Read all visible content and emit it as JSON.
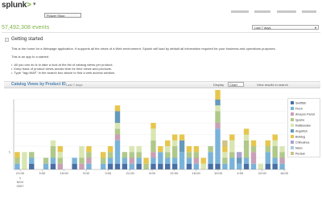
{
  "header": {
    "logo_text": "splunk",
    "logo_suffix": ">",
    "app_select_value": "Flower Shop",
    "app_select_caret": "▾"
  },
  "search": {
    "events_count": "57,492,308 events",
    "time_range": "Last 7 days",
    "time_range_caret": "▾"
  },
  "getting_started": {
    "title": "Getting started",
    "paragraph_1": "This is the home for a Webpage application. It supports all the views of a Web environment. Splunk will load by default all information required for your business and operations purposes.",
    "paragraph_2": "This is an app to a started.",
    "bullets": [
      "All you can do is to take a look at the list of catalog views per product.",
      "Keep track of product views across time for time views and products.",
      "Type \"tag=WAF\" in the search box above to find a web access window."
    ]
  },
  "panel": {
    "title": "Catalog Views by Product ID",
    "subtitle": "Last 7 days",
    "display_label": "Display",
    "display_value": "Chart",
    "link_text": "View results in search"
  },
  "chart_data": {
    "type": "bar",
    "stacked": true,
    "ylim": [
      0,
      12
    ],
    "y_ticks": [
      "1"
    ],
    "x_tick_labels": [
      "21:00",
      "3:00",
      "15:00",
      "9:00",
      "3:00",
      "21:00",
      "9:00",
      "22:00",
      "16:00",
      "10:00",
      "4:00",
      "22:00",
      "16:00"
    ],
    "date_label_day": "1",
    "date_label_month": "NOV",
    "date_label_year": "2007",
    "series": [
      {
        "name": "Swiftfish",
        "color": "#4a6fa5",
        "values": [
          0,
          0,
          1,
          0,
          0,
          1,
          0,
          0,
          1,
          0,
          0,
          0,
          0,
          1,
          1,
          1,
          0,
          1,
          0,
          1,
          1,
          1,
          1,
          0,
          1,
          0,
          0,
          1,
          1,
          0,
          0,
          0,
          1,
          0,
          0,
          1,
          1,
          0
        ]
      },
      {
        "name": "Finch",
        "color": "#7ab3d9",
        "values": [
          1,
          0,
          1,
          0,
          1,
          1,
          0,
          0,
          1,
          0,
          1,
          0,
          1,
          1,
          4,
          1,
          1,
          1,
          0,
          1,
          2,
          1,
          1,
          3,
          1,
          1,
          0,
          2,
          6,
          1,
          2,
          1,
          1,
          1,
          0,
          2,
          1,
          1
        ]
      },
      {
        "name": "Amazon Parrot",
        "color": "#c9a0b5",
        "values": [
          0,
          0,
          0,
          0,
          0,
          0,
          1,
          0,
          0,
          1,
          1,
          0,
          0,
          0,
          1,
          0,
          1,
          0,
          0,
          1,
          0,
          0,
          0,
          0,
          0,
          1,
          0,
          0,
          1,
          0,
          0,
          0,
          0,
          2,
          0,
          0,
          0,
          1
        ]
      },
      {
        "name": "Iguana",
        "color": "#b0c88a",
        "values": [
          1,
          0,
          1,
          0,
          1,
          2,
          1,
          0,
          0,
          1,
          1,
          0,
          1,
          1,
          1,
          1,
          1,
          1,
          1,
          2,
          0,
          1,
          2,
          0,
          1,
          1,
          0,
          1,
          2,
          1,
          1,
          0,
          3,
          1,
          0,
          1,
          2,
          1
        ]
      },
      {
        "name": "Rattlesnake",
        "color": "#d9e6b3",
        "values": [
          0,
          3,
          0,
          0,
          0,
          1,
          1,
          0,
          0,
          2,
          0,
          0,
          0,
          0,
          1,
          0,
          1,
          1,
          0,
          2,
          0,
          1,
          1,
          0,
          0,
          0,
          1,
          0,
          1,
          1,
          2,
          0,
          1,
          0,
          1,
          0,
          1,
          1
        ]
      },
      {
        "name": "Angelfish",
        "color": "#6699bb",
        "values": [
          0,
          0,
          0,
          0,
          0,
          0,
          0,
          0,
          0,
          0,
          0,
          0,
          0,
          0,
          2,
          0,
          0,
          0,
          0,
          0,
          0,
          0,
          0,
          2,
          0,
          0,
          0,
          0,
          1,
          0,
          0,
          1,
          0,
          0,
          0,
          0,
          0,
          0
        ]
      },
      {
        "name": "Bulldog",
        "color": "#e6c64d",
        "values": [
          1,
          0,
          0,
          0,
          0,
          0,
          1,
          0,
          0,
          0,
          1,
          0,
          1,
          1,
          1,
          0,
          0,
          0,
          1,
          1,
          1,
          1,
          1,
          1,
          1,
          1,
          1,
          0,
          2,
          1,
          1,
          0,
          1,
          1,
          0,
          1,
          1,
          0
        ]
      },
      {
        "name": "Chihuahua",
        "color": "#ada3d1",
        "values": [
          0,
          0,
          0,
          0,
          0,
          0,
          0,
          0,
          0,
          0,
          0,
          0,
          0,
          0,
          0,
          0,
          0,
          0,
          0,
          0,
          0,
          0,
          0,
          0,
          0,
          0,
          0,
          0,
          0,
          0,
          0,
          1,
          0,
          0,
          0,
          0,
          0,
          0
        ]
      },
      {
        "name": "Manx",
        "color": "#aacbe0",
        "values": [
          0,
          0,
          0,
          0,
          0,
          0,
          0,
          0,
          0,
          0,
          0,
          0,
          0,
          0,
          0,
          0,
          0,
          0,
          0,
          0,
          0,
          0,
          0,
          0,
          0,
          0,
          0,
          0,
          1,
          0,
          0,
          0,
          0,
          0,
          0,
          0,
          0,
          0
        ]
      },
      {
        "name": "Persian",
        "color": "#cfc28a",
        "values": [
          0,
          0,
          0,
          0,
          0,
          0,
          0,
          0,
          0,
          0,
          0,
          0,
          0,
          0,
          0,
          0,
          0,
          0,
          0,
          0,
          0,
          0,
          0,
          0,
          0,
          0,
          0,
          0,
          0,
          1,
          0,
          0,
          0,
          0,
          0,
          0,
          0,
          0
        ]
      }
    ]
  }
}
